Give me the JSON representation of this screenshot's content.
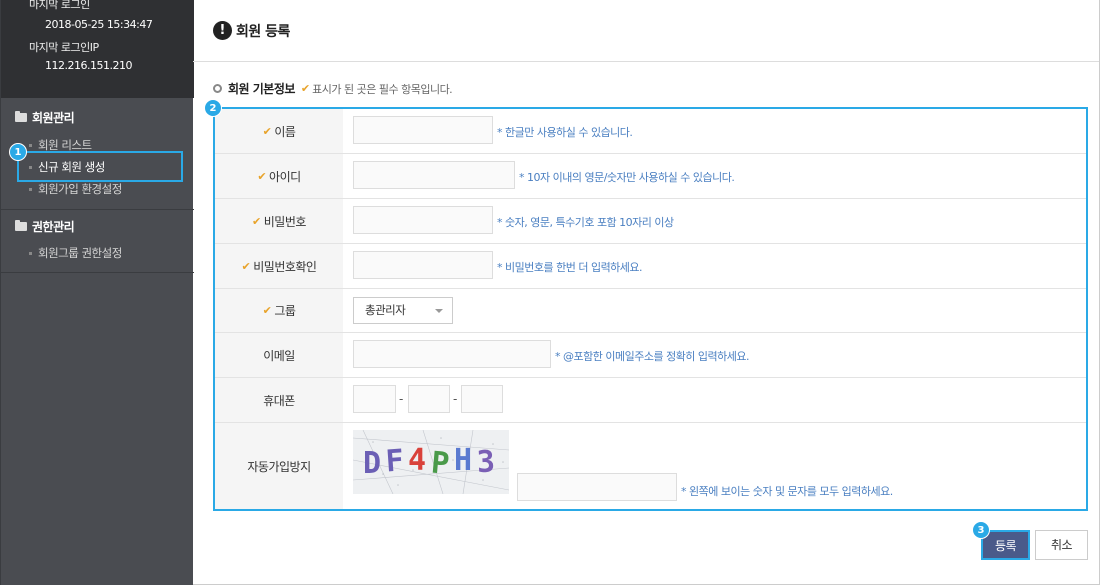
{
  "sidebar": {
    "last_login_label": "마지막 로그인",
    "last_login_value": "2018-05-25 15:34:47",
    "last_ip_label": "마지막 로그인IP",
    "last_ip_value": "112.216.151.210",
    "sections": [
      {
        "title": "회원관리",
        "items": [
          "회원 리스트",
          "신규 회원 생성",
          "회원가입 환경설정"
        ]
      },
      {
        "title": "권한관리",
        "items": [
          "회원그룹 권한설정"
        ]
      }
    ]
  },
  "header": {
    "icon": "!",
    "title": "회원 등록"
  },
  "subheader": {
    "title": "회원 기본정보",
    "note": "표시가 된 곳은 필수 항목입니다."
  },
  "required_mark": "✔",
  "form": {
    "name": {
      "label": "이름",
      "hint": "* 한글만 사용하실 수 있습니다.",
      "value": ""
    },
    "id": {
      "label": "아이디",
      "hint": "* 10자 이내의 영문/숫자만 사용하실 수 있습니다.",
      "value": ""
    },
    "password": {
      "label": "비밀번호",
      "hint": "* 숫자, 영문, 특수기호 포함 10자리 이상",
      "value": ""
    },
    "password_confirm": {
      "label": "비밀번호확인",
      "hint": "* 비밀번호를 한번 더 입력하세요.",
      "value": ""
    },
    "group": {
      "label": "그룹",
      "selected": "총관리자"
    },
    "email": {
      "label": "이메일",
      "hint": "* @포함한 이메일주소를 정확히 입력하세요.",
      "value": ""
    },
    "phone": {
      "label": "휴대폰",
      "separator": "-"
    },
    "captcha": {
      "label": "자동가입방지",
      "text": "DF4PH3",
      "hint": "* 왼쪽에 보이는 숫자 및 문자를 모두 입력하세요.",
      "value": ""
    }
  },
  "buttons": {
    "submit": "등록",
    "cancel": "취소"
  },
  "badges": {
    "b1": "1",
    "b2": "2",
    "b3": "3"
  },
  "colors": {
    "highlight": "#2aa9e6",
    "required": "#e8a32a",
    "hint": "#4a7fc1",
    "primary": "#4a5a8a"
  }
}
